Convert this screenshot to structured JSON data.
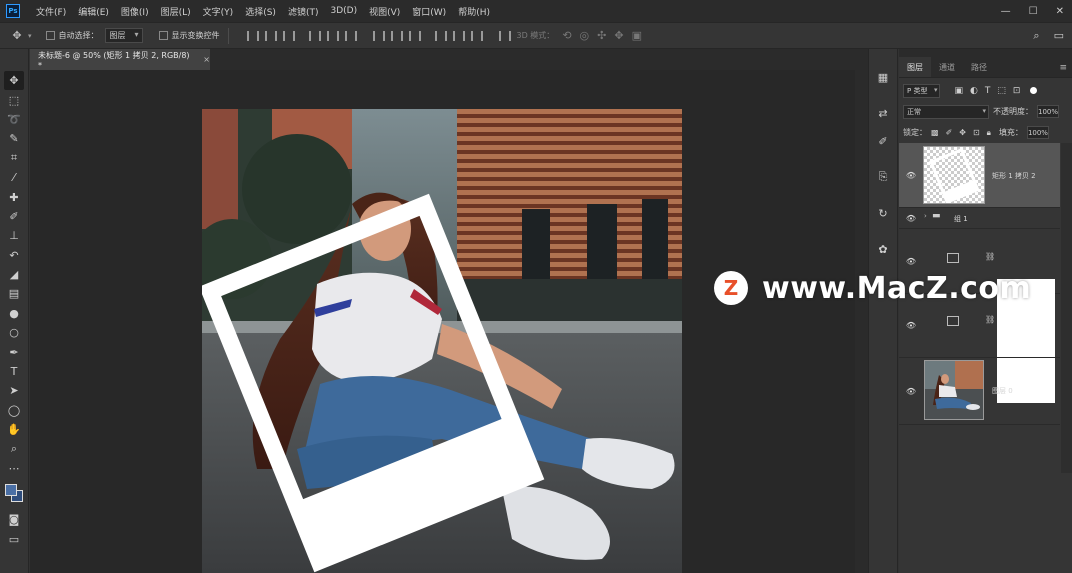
{
  "app": {
    "logo": "Ps"
  },
  "menu": [
    "文件(F)",
    "编辑(E)",
    "图像(I)",
    "图层(L)",
    "文字(Y)",
    "选择(S)",
    "滤镜(T)",
    "3D(D)",
    "视图(V)",
    "窗口(W)",
    "帮助(H)"
  ],
  "window_controls": {
    "minimize": "—",
    "maximize": "☐",
    "close": "✕"
  },
  "options": {
    "auto_select_label": "自动选择：",
    "auto_select_target": "图层",
    "show_transform_label": "显示变换控件",
    "mode_3d_label": "3D 模式："
  },
  "document": {
    "tab_title": "未标题-6 @ 50% (矩形 1 拷贝 2, RGB/8) *",
    "close": "×"
  },
  "colors": {
    "foreground": "#4a6fa5",
    "background": "#2f4d7c",
    "accent": "#31a8ff"
  },
  "layers_panel": {
    "tabs": [
      "图层",
      "通道",
      "路径"
    ],
    "menu_icon": "≡",
    "filter_kind": "P 类型",
    "blend_mode": "正常",
    "opacity_label": "不透明度：",
    "opacity_value": "100%",
    "lock_label": "锁定：",
    "fill_label": "填充：",
    "fill_value": "100%",
    "layers": [
      {
        "name": "矩形 1 拷贝 2",
        "selected": true
      },
      {
        "name": "组 1",
        "type": "group"
      },
      {
        "name": "",
        "type": "adjustment"
      },
      {
        "name": "",
        "type": "adjustment"
      },
      {
        "name": "图层 0",
        "type": "image"
      }
    ]
  },
  "watermark": {
    "logo_letter": "Z",
    "text": "www.MacZ.com"
  }
}
